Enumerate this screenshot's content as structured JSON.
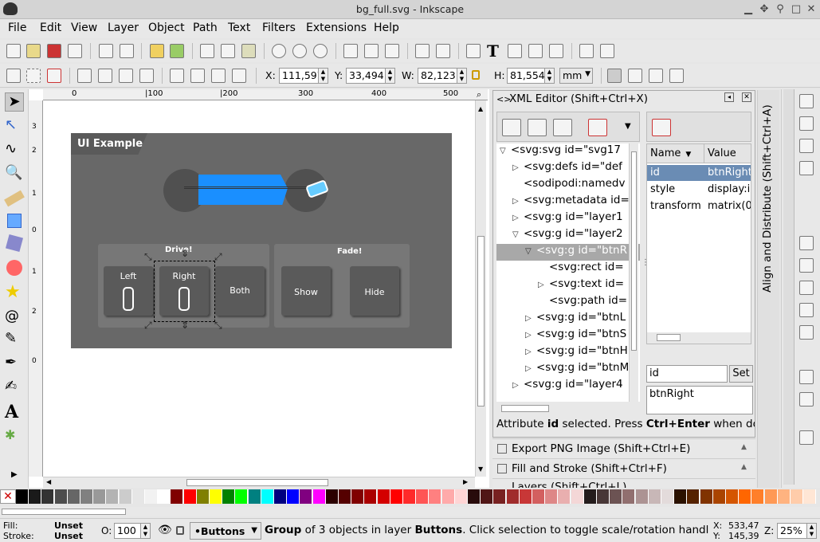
{
  "window": {
    "title": "bg_full.svg - Inkscape"
  },
  "menu": [
    {
      "label": "File"
    },
    {
      "label": "Edit"
    },
    {
      "label": "View"
    },
    {
      "label": "Layer"
    },
    {
      "label": "Object"
    },
    {
      "label": "Path"
    },
    {
      "label": "Text"
    },
    {
      "label": "Filters"
    },
    {
      "label": "Extensions"
    },
    {
      "label": "Help"
    }
  ],
  "toolcontrols": {
    "x_label": "X:",
    "x": "111,597",
    "y_label": "Y:",
    "y": "33,494",
    "w_label": "W:",
    "w": "82,123",
    "h_label": "H:",
    "h": "81,554",
    "unit": "mm"
  },
  "rulers": {
    "top": [
      "0",
      "|100",
      "|200",
      "300",
      "400",
      "500"
    ],
    "left": [
      "3",
      "2",
      "1",
      "0",
      "1",
      "2",
      "0"
    ]
  },
  "canvas": {
    "doc_title": "UI Example",
    "drive_label": "Drive!",
    "fade_label": "Fade!",
    "btn_left": "Left",
    "btn_right": "Right",
    "btn_both": "Both",
    "btn_show": "Show",
    "btn_hide": "Hide"
  },
  "xml": {
    "title": "XML Editor (Shift+Ctrl+X)",
    "nodes": [
      "<svg:svg id=\"svg17",
      "<svg:defs id=\"def",
      "<sodipodi:namedv",
      "<svg:metadata id=",
      "<svg:g id=\"layer1",
      "<svg:g id=\"layer2",
      "<svg:g id=\"btnR",
      "<svg:rect id=",
      "<svg:text id=",
      "<svg:path id=",
      "<svg:g id=\"btnL",
      "<svg:g id=\"btnS",
      "<svg:g id=\"btnH",
      "<svg:g id=\"btnM",
      "<svg:g id=\"layer4"
    ],
    "attr_headers": {
      "name": "Name",
      "value": "Value"
    },
    "attrs": [
      {
        "name": "id",
        "value": "btnRight"
      },
      {
        "name": "style",
        "value": "display:i"
      },
      {
        "name": "transform",
        "value": "matrix(0"
      }
    ],
    "attr_name_input": "id",
    "set_label": "Set",
    "attr_value": "btnRight",
    "status_pre": "Attribute ",
    "status_bold": "id",
    "status_mid": " selected. Press ",
    "status_key": "Ctrl+Enter",
    "status_post": " when do"
  },
  "docks": [
    {
      "label": "Export PNG Image (Shift+Ctrl+E)"
    },
    {
      "label": "Fill and Stroke (Shift+Ctrl+F)"
    },
    {
      "label": "Layers (Shift+Ctrl+L)"
    }
  ],
  "side_tab": "Align and Distribute (Shift+Ctrl+A)",
  "status": {
    "fill_label": "Fill:",
    "fill_value": "Unset",
    "stroke_label": "Stroke:",
    "stroke_value": "Unset",
    "opacity_label": "O:",
    "opacity": "100",
    "layer": "•Buttons",
    "message_bold": "Group",
    "message_mid": " of 3 objects in layer ",
    "message_bold2": "Buttons",
    "message_post": ". Click selection to toggle scale/rotation handl...",
    "x_label": "X:",
    "x": "533,47",
    "y_label": "Y:",
    "y": "145,39",
    "zoom_label": "Z:",
    "zoom": "25%"
  },
  "palette_colors": [
    "#000000",
    "#1a1a1a",
    "#333333",
    "#4d4d4d",
    "#666666",
    "#808080",
    "#999999",
    "#b3b3b3",
    "#cccccc",
    "#e6e6e6",
    "#f2f2f2",
    "#ffffff",
    "#800000",
    "#ff0000",
    "#808000",
    "#ffff00",
    "#008000",
    "#00ff00",
    "#008080",
    "#00ffff",
    "#000080",
    "#0000ff",
    "#800080",
    "#ff00ff",
    "#2b0000",
    "#550000",
    "#800000",
    "#aa0000",
    "#d40000",
    "#ff0000",
    "#ff2a2a",
    "#ff5555",
    "#ff8080",
    "#ffaaaa",
    "#ffd5d5",
    "#280b0b",
    "#501616",
    "#782121",
    "#a02c2c",
    "#c83737",
    "#d35f5f",
    "#de8787",
    "#e9afaf",
    "#f4d7d7",
    "#241c1c",
    "#483737",
    "#6c5353",
    "#916f6f",
    "#ac9393",
    "#c8b7b7",
    "#e3dbdb",
    "#2b1100",
    "#552200",
    "#803300",
    "#aa4400",
    "#d45500",
    "#ff6600",
    "#ff7f2a",
    "#ff9955",
    "#ffb380",
    "#ffccaa",
    "#ffe6d5"
  ]
}
